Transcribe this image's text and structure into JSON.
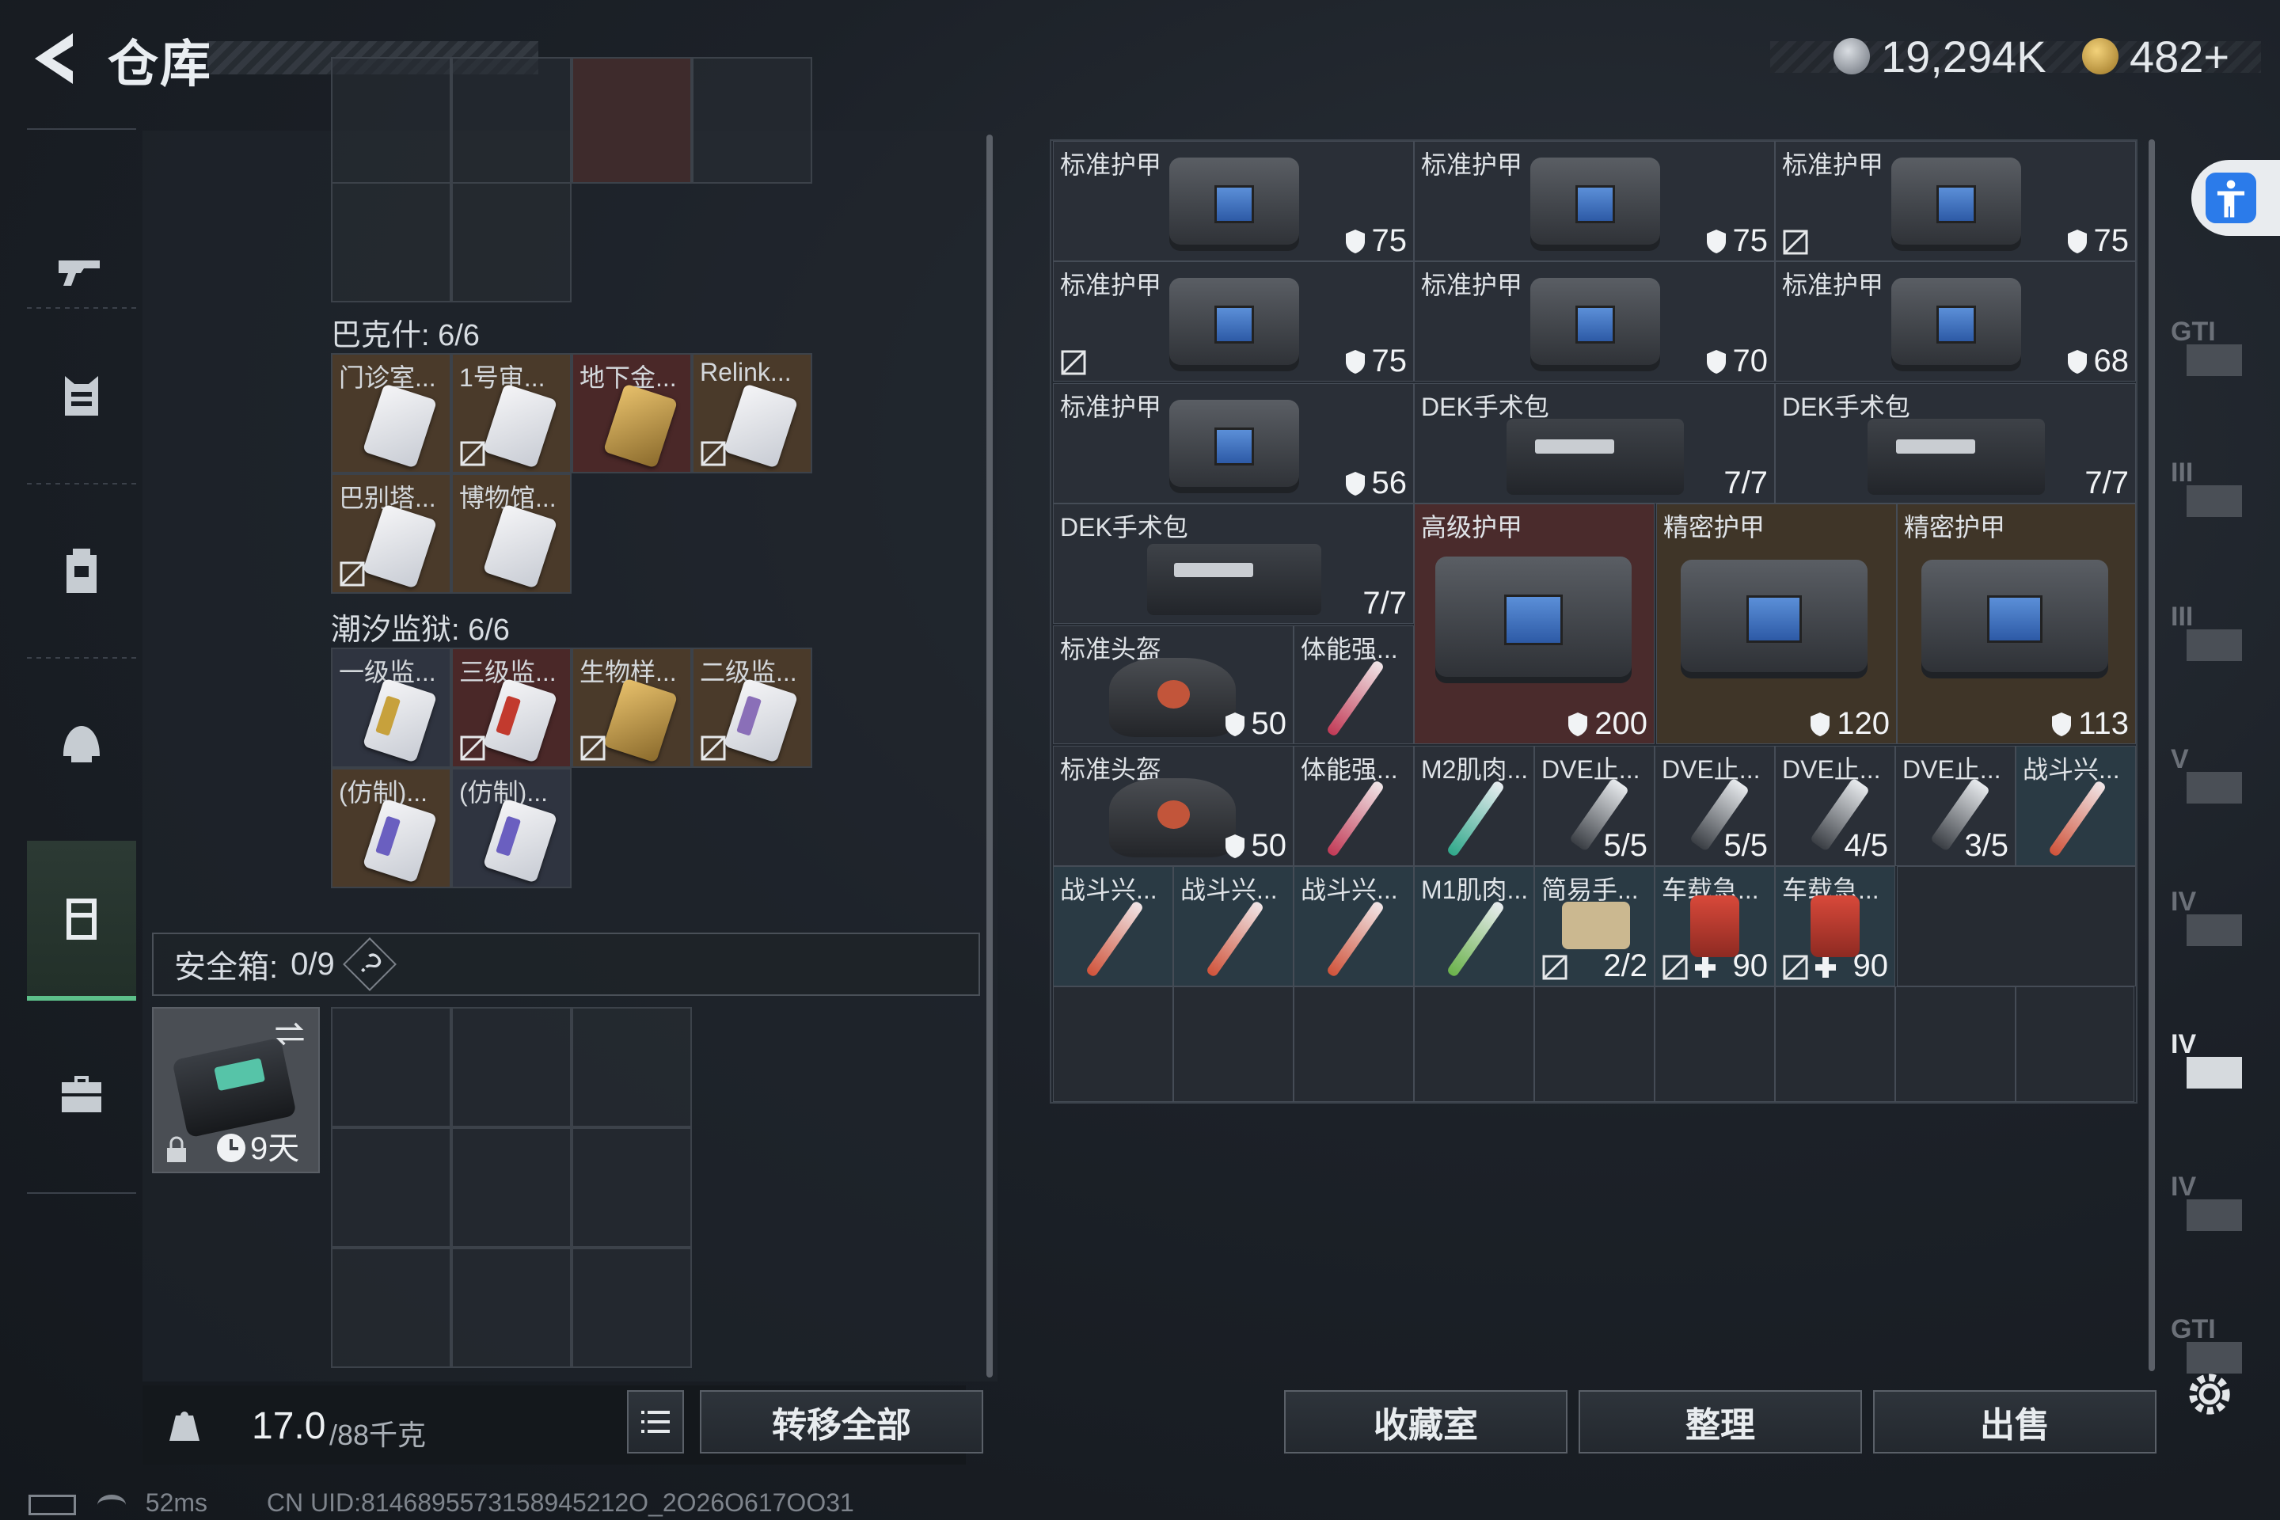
{
  "header": {
    "title": "仓库",
    "currency1": "19,294K",
    "currency2": "482+"
  },
  "left_nav": {
    "items": [
      "gun-icon",
      "armor-icon",
      "backpack-icon",
      "helmet-icon",
      "container-icon",
      "briefcase-icon"
    ]
  },
  "sections": {
    "top_partial": [
      {
        "label": ""
      },
      {
        "label": ""
      },
      {
        "label": ""
      },
      {
        "label": ""
      }
    ],
    "bakeshi": {
      "title": "巴克什: 6/6",
      "items": [
        "门诊室...",
        "1号审...",
        "地下金...",
        "Relink...",
        "巴别塔...",
        "博物馆..."
      ]
    },
    "chaoxi": {
      "title": "潮汐监狱: 6/6",
      "items": [
        "一级监...",
        "三级监...",
        "生物样...",
        "二级监...",
        "(仿制)...",
        "(仿制)..."
      ]
    }
  },
  "safe": {
    "label": "安全箱:",
    "count": "0/9",
    "help": "?",
    "duration": "9天"
  },
  "footer_left": {
    "weight": "17.0",
    "weight_max": "/88千克",
    "transfer_all": "转移全部"
  },
  "inventory": {
    "rows": [
      [
        {
          "label": "标准护甲",
          "value": "75"
        },
        {
          "label": "标准护甲",
          "value": "75"
        },
        {
          "label": "标准护甲",
          "value": "75"
        }
      ],
      [
        {
          "label": "标准护甲",
          "value": "75"
        },
        {
          "label": "标准护甲",
          "value": "70"
        },
        {
          "label": "标准护甲",
          "value": "68"
        }
      ],
      [
        {
          "label": "标准护甲",
          "value": "56"
        },
        {
          "label": "DEK手术包",
          "value": "7/7"
        },
        {
          "label": "DEK手术包",
          "value": "7/7"
        }
      ]
    ],
    "dek3": {
      "label": "DEK手术包",
      "value": "7/7"
    },
    "big": [
      {
        "label": "高级护甲",
        "value": "200"
      },
      {
        "label": "精密护甲",
        "value": "120"
      },
      {
        "label": "精密护甲",
        "value": "113"
      }
    ],
    "helmet1": {
      "label": "标准头盔",
      "value": "50"
    },
    "helmet2": {
      "label": "标准头盔",
      "value": "50"
    },
    "small_row1": {
      "label": "体能强..."
    },
    "small_row2": [
      {
        "label": "体能强...",
        "value": ""
      },
      {
        "label": "M2肌肉...",
        "value": ""
      },
      {
        "label": "DVE止...",
        "value": "5/5"
      },
      {
        "label": "DVE止...",
        "value": "5/5"
      },
      {
        "label": "DVE止...",
        "value": "4/5"
      },
      {
        "label": "DVE止...",
        "value": "3/5"
      },
      {
        "label": "战斗兴...",
        "value": ""
      }
    ],
    "small_row3": [
      {
        "label": "战斗兴...",
        "value": ""
      },
      {
        "label": "战斗兴...",
        "value": ""
      },
      {
        "label": "战斗兴...",
        "value": ""
      },
      {
        "label": "M1肌肉...",
        "value": ""
      },
      {
        "label": "简易手...",
        "value": "2/2"
      },
      {
        "label": "车载急...",
        "value": "90"
      },
      {
        "label": "车载急...",
        "value": "90"
      }
    ]
  },
  "right_nav": {
    "items": [
      "GTI",
      "III",
      "III",
      "V",
      "IV",
      "IV",
      "IV",
      "GTI"
    ]
  },
  "footer_right": {
    "collection": "收藏室",
    "sort": "整理",
    "sell": "出售"
  },
  "status": {
    "ping": "52ms",
    "uid": "CN UID:8146895573158945212O_2O26O617OO31"
  },
  "colors": {
    "accent_green": "#5dc08a",
    "rare_red": "#4a2a2a",
    "rare_gold": "#4a3a24",
    "accessibility": "#2b7bea"
  }
}
